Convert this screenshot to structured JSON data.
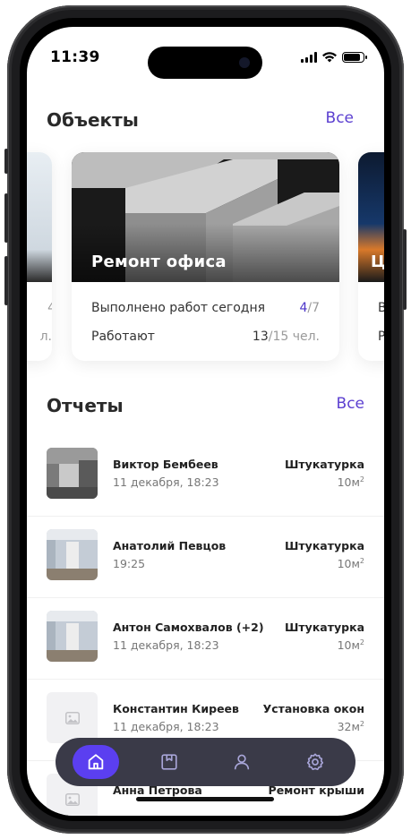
{
  "status": {
    "time": "11:39"
  },
  "objects": {
    "title": "Объекты",
    "see_all": "Все",
    "left_card": {
      "partial_done": "4",
      "partial_workers": "л."
    },
    "main_card": {
      "title": "Ремонт офиса",
      "done_label": "Выполнено работ сегодня",
      "done_value": "4",
      "done_total": "/7",
      "workers_label": "Работают",
      "workers_value": "13",
      "workers_total": "/15 чел."
    },
    "right_card": {
      "title_partial": "Ц",
      "row1_partial": "В",
      "row2_partial": "Р"
    }
  },
  "reports": {
    "title": "Отчеты",
    "see_all": "Все",
    "items": [
      {
        "name": "Виктор Бембеев",
        "time": "11 декабря, 18:23",
        "type": "Штукатурка",
        "area": "10м",
        "unit_sup": "2"
      },
      {
        "name": "Анатолий Певцов",
        "time": "19:25",
        "type": "Штукатурка",
        "area": "10м",
        "unit_sup": "2"
      },
      {
        "name": "Антон Самохвалов (+2)",
        "time": "11 декабря, 18:23",
        "type": "Штукатурка",
        "area": "10м",
        "unit_sup": "2"
      },
      {
        "name": "Константин Киреев",
        "time": "11 декабря, 18:23",
        "type": "Установка окон",
        "area": "32м",
        "unit_sup": "2"
      },
      {
        "name": "Анна Петрова",
        "time": "",
        "type": "Ремонт крыши",
        "area": "",
        "unit_sup": ""
      }
    ]
  },
  "tabbar": {
    "tabs": [
      {
        "icon": "home-icon",
        "active": true
      },
      {
        "icon": "bookmark-icon",
        "active": false
      },
      {
        "icon": "user-icon",
        "active": false
      },
      {
        "icon": "gear-icon",
        "active": false
      }
    ]
  },
  "colors": {
    "accent": "#5b3ff0",
    "link": "#5b3fd0",
    "tabbar": "#3a3a48"
  }
}
